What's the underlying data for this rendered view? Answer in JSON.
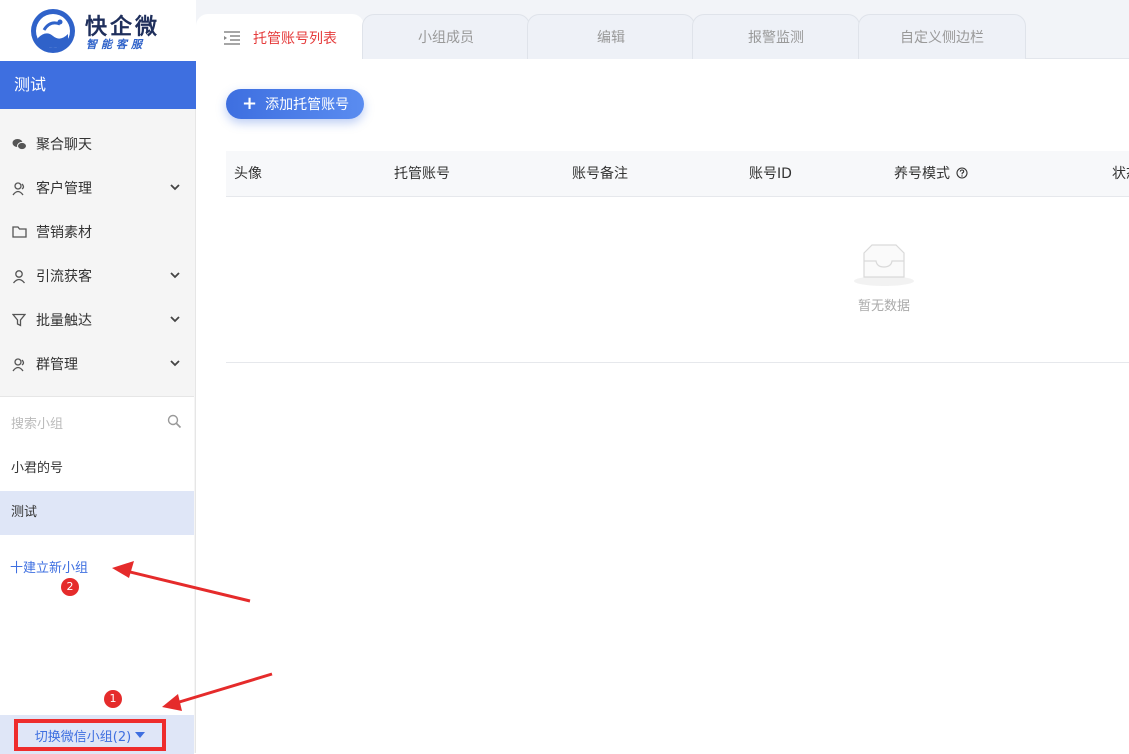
{
  "brand": {
    "name": "快企微",
    "tagline": "智能客服"
  },
  "sidebar": {
    "group_title": "测试",
    "menu": [
      {
        "label": "聚合聊天",
        "icon": "wechat-icon",
        "expandable": false
      },
      {
        "label": "客户管理",
        "icon": "customers-icon",
        "expandable": true
      },
      {
        "label": "营销素材",
        "icon": "folder-icon",
        "expandable": false
      },
      {
        "label": "引流获客",
        "icon": "user-icon",
        "expandable": true
      },
      {
        "label": "批量触达",
        "icon": "funnel-icon",
        "expandable": true
      },
      {
        "label": "群管理",
        "icon": "group-icon",
        "expandable": true
      }
    ],
    "search_placeholder": "搜索小组",
    "groups": [
      {
        "label": "小君的号",
        "active": false
      },
      {
        "label": "测试",
        "active": true
      }
    ],
    "new_group_label": "十建立新小组",
    "switch_label": "切换微信小组(2)"
  },
  "tabs": [
    {
      "label": "托管账号列表",
      "active": true
    },
    {
      "label": "小组成员",
      "active": false
    },
    {
      "label": "编辑",
      "active": false
    },
    {
      "label": "报警监测",
      "active": false
    },
    {
      "label": "自定义侧边栏",
      "active": false
    }
  ],
  "toolbar": {
    "add_label": "添加托管账号"
  },
  "table": {
    "columns": [
      "头像",
      "托管账号",
      "账号备注",
      "账号ID",
      "养号模式",
      "状态"
    ],
    "rows": [],
    "empty_text": "暂无数据"
  },
  "annotations": {
    "badge_1": "1",
    "badge_2": "2"
  },
  "colors": {
    "accent": "#3e6fe0",
    "active_tab_text": "#e53b3b",
    "annotation_red": "#e52b2b"
  }
}
